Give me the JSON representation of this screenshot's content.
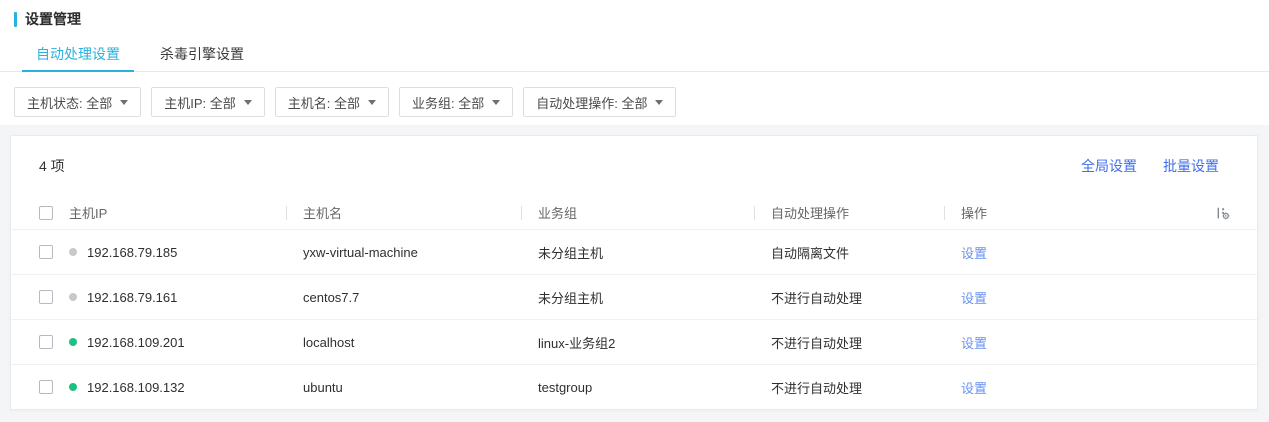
{
  "page": {
    "title": "设置管理"
  },
  "tabs": [
    {
      "label": "自动处理设置",
      "active": true
    },
    {
      "label": "杀毒引擎设置",
      "active": false
    }
  ],
  "filters": [
    {
      "id": "host-status",
      "name": "主机状态",
      "value": "全部"
    },
    {
      "id": "host-ip",
      "name": "主机IP",
      "value": "全部"
    },
    {
      "id": "host-name",
      "name": "主机名",
      "value": "全部"
    },
    {
      "id": "business-group",
      "name": "业务组",
      "value": "全部"
    },
    {
      "id": "auto-handle-operation",
      "name": "自动处理操作",
      "value": "全部"
    }
  ],
  "card": {
    "count_label": "4 项",
    "links": [
      {
        "id": "global-settings",
        "label": "全局设置"
      },
      {
        "id": "batch-settings",
        "label": "批量设置"
      }
    ],
    "table": {
      "columns": [
        "主机IP",
        "主机名",
        "业务组",
        "自动处理操作",
        "操作"
      ],
      "rows": [
        {
          "status": "offline",
          "ip": "192.168.79.185",
          "hostname": "yxw-virtual-machine",
          "group": "未分组主机",
          "operation": "自动隔离文件",
          "action": "设置"
        },
        {
          "status": "offline",
          "ip": "192.168.79.161",
          "hostname": "centos7.7",
          "group": "未分组主机",
          "operation": "不进行自动处理",
          "action": "设置"
        },
        {
          "status": "online",
          "ip": "192.168.109.201",
          "hostname": "localhost",
          "group": "linux-业务组2",
          "operation": "不进行自动处理",
          "action": "设置"
        },
        {
          "status": "online",
          "ip": "192.168.109.132",
          "hostname": "ubuntu",
          "group": "testgroup",
          "operation": "不进行自动处理",
          "action": "设置"
        }
      ]
    }
  },
  "icons": {
    "filter_caret": "chevron-down",
    "column_settings": "divider-dots-gear"
  },
  "colors": {
    "accent": "#29b2e0",
    "link": "#3f6eea",
    "row_link": "#6a91f2",
    "dot_green": "#1fbf83",
    "dot_gray": "#c9c9c9"
  }
}
